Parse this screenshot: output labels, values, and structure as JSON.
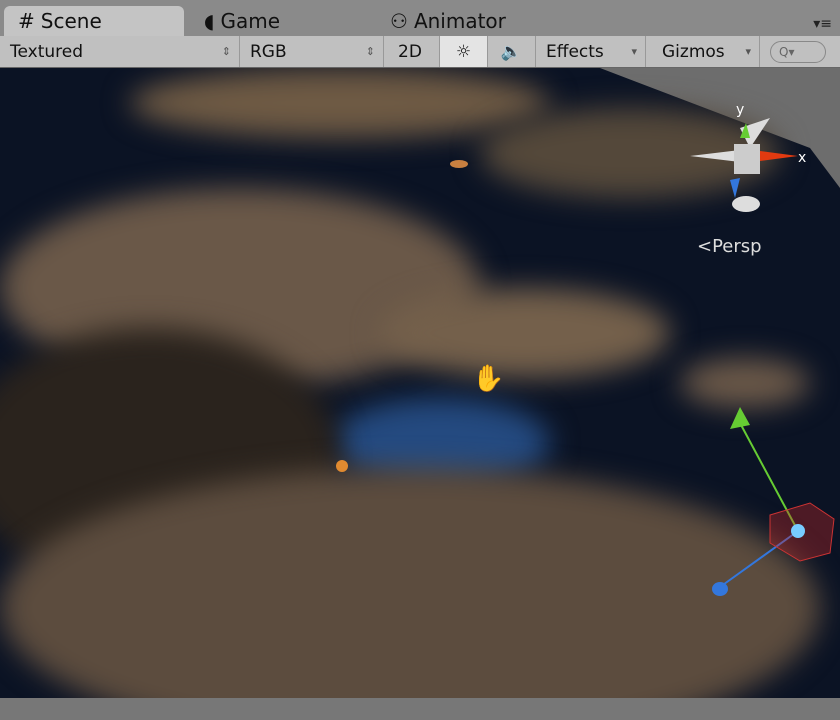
{
  "tabs": [
    {
      "label": "Scene",
      "icon": "hash-icon",
      "glyph": "#"
    },
    {
      "label": "Game",
      "icon": "pacman-icon",
      "glyph": "◖"
    },
    {
      "label": "Animator",
      "icon": "animator-icon",
      "glyph": "⚇"
    }
  ],
  "toolbar": {
    "draw_mode": "Textured",
    "render_mode": "RGB",
    "mode_2d": "2D",
    "lighting": "☼",
    "audio": "🔈",
    "effects": "Effects",
    "gizmos": "Gizmos",
    "search_placeholder": "Q▾"
  },
  "scene": {
    "camera_label": "Persp",
    "axis_x": "x",
    "axis_y": "y"
  }
}
